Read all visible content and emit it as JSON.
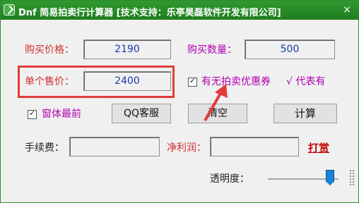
{
  "window": {
    "title": "Dnf 简易拍卖行计算器    [技术支持：乐亭昊磊软件开发有限公司]",
    "close_icon": "×"
  },
  "purchase": {
    "price_label": "购买价格：",
    "price_value": "2190",
    "quantity_label": "购买数量：",
    "quantity_value": "500"
  },
  "sale": {
    "unit_price_label": "单个售价：",
    "unit_price_value": "2400"
  },
  "options": {
    "coupon_label": "有无拍卖优惠券",
    "coupon_note": "√ 代表有",
    "topmost_label": "窗体最前"
  },
  "buttons": {
    "qq": "QQ客服",
    "clear": "清空",
    "calculate": "计算"
  },
  "results": {
    "fee_label": "手续费：",
    "fee_value": "",
    "profit_label": "净利润：",
    "profit_value": "",
    "reward_link": "打赏"
  },
  "transparency": {
    "label": "透明度：",
    "level": 0.88
  },
  "colors": {
    "titlebar": "#2f9a2f",
    "highlight": "#e33b3b",
    "input_text": "#1c39a8",
    "label_red": "#d03030",
    "label_purple": "#b000b0"
  }
}
